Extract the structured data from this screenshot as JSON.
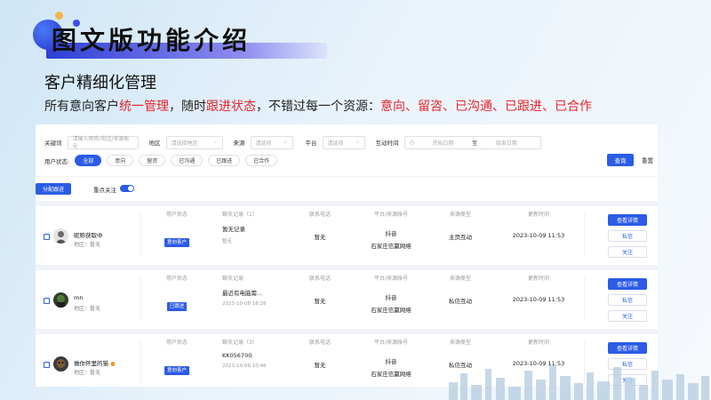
{
  "slide": {
    "title": "图文版功能介绍",
    "subtitle": "客户精细化管理",
    "desc_parts": [
      {
        "text": "所有意向客户",
        "red": false
      },
      {
        "text": "统一管理",
        "red": true
      },
      {
        "text": "，随时",
        "red": false
      },
      {
        "text": "跟进状态",
        "red": true
      },
      {
        "text": "，不错过每一个资源：",
        "red": false
      },
      {
        "text": "意向、留咨、已沟通、已跟进、已合作",
        "red": true
      }
    ]
  },
  "filters": {
    "keyword_label": "关键词",
    "keyword_placeholder": "请输入昵称/电话/来源账号",
    "region_label": "地区",
    "region_placeholder": "请选择地区",
    "source_label": "来源",
    "source_placeholder": "请选择",
    "platform_label": "平台",
    "platform_placeholder": "请选择",
    "time_label": "互动时间",
    "start_placeholder": "开始日期",
    "to": "至",
    "end_placeholder": "结束日期",
    "status_label": "用户状态:",
    "status_options": [
      "全部",
      "意向",
      "留资",
      "已沟通",
      "已跟进",
      "已合作"
    ],
    "query_button": "查询",
    "reset_button": "重置"
  },
  "toolbar": {
    "assign_button": "分配跟进",
    "focus_label": "重点关注"
  },
  "columns": {
    "status": "用户状态",
    "chat": "聊天记录",
    "phone": "联系电话",
    "platform": "平台/来源账号",
    "source_type": "来源类型",
    "update_time": "更新时间"
  },
  "buttons": {
    "detail": "查看详情",
    "message": "私信",
    "follow": "关注"
  },
  "customers": [
    {
      "name": "昵称获取中",
      "area": "地区：暂无",
      "status": "意向客户",
      "chat_header": "聊天记录（1）",
      "chat_main": "暂无记录",
      "chat_sub": "暂无",
      "phone": "暂无",
      "platform": "抖音",
      "account": "石家庄信赢网络",
      "source_type": "主页互动",
      "update_time": "2023-10-09 11:53"
    },
    {
      "name": "mn",
      "area": "地区：暂无",
      "status": "已跟进",
      "chat_header": "聊天记录",
      "chat_main": "最近有电脑需...",
      "chat_sub": "2023-10-08 16:26",
      "phone": "暂无",
      "platform": "抖音",
      "account": "石家庄信赢网络",
      "source_type": "私信互动",
      "update_time": "2023-10-09 11:53"
    },
    {
      "name": "做你怀里的猫",
      "area": "地区：暂无",
      "status": "意向客户",
      "chat_header": "聊天记录（3）",
      "chat_main": "KK056700",
      "chat_sub": "2023-10-09 10:46",
      "phone": "暂无",
      "platform": "抖音",
      "account": "石家庄信赢网络",
      "source_type": "私信互动",
      "update_time": "2023-10-09 11:53"
    }
  ],
  "colors": {
    "accent": "#2b5ce6",
    "highlight_red": "#e8242b"
  }
}
